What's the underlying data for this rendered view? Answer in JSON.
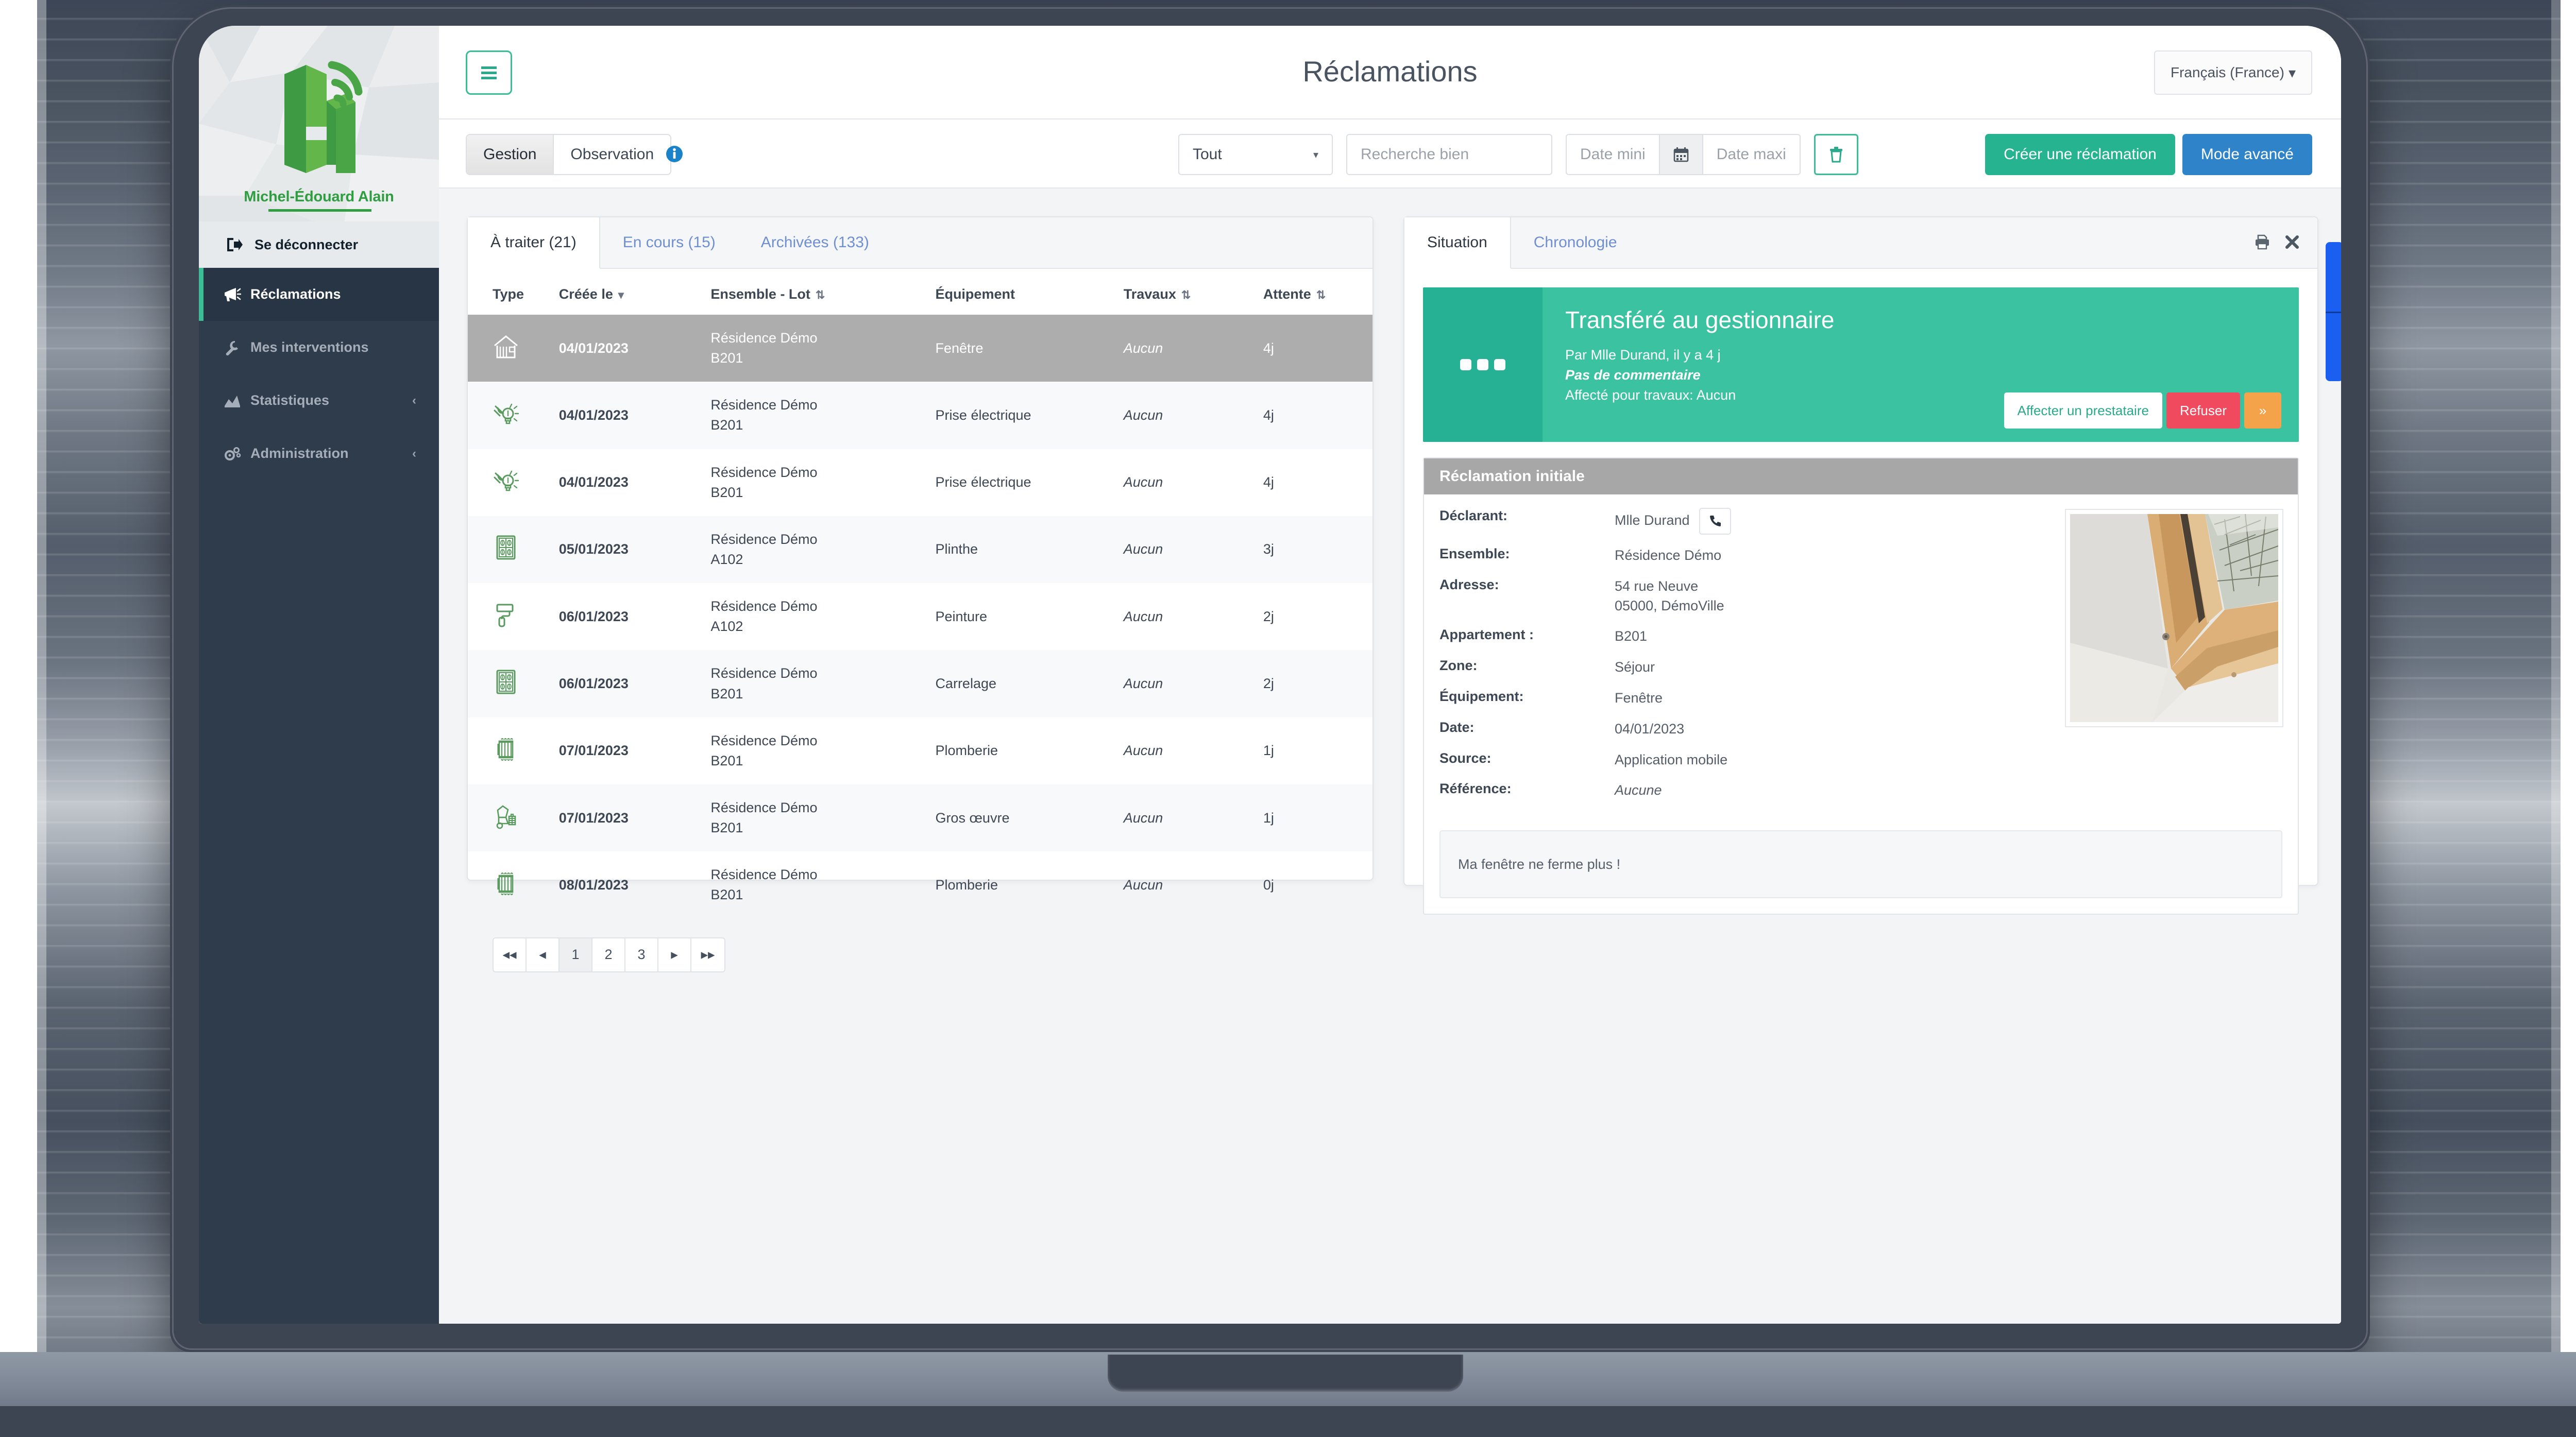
{
  "sidebar": {
    "brand_name": "Michel-Édouard Alain",
    "logout_label": "Se déconnecter",
    "items": [
      {
        "label": "Réclamations",
        "icon": "megaphone-icon",
        "active": true,
        "chevron": ""
      },
      {
        "label": "Mes interventions",
        "icon": "wrench-icon",
        "active": false,
        "chevron": ""
      },
      {
        "label": "Statistiques",
        "icon": "chart-icon",
        "active": false,
        "chevron": "‹"
      },
      {
        "label": "Administration",
        "icon": "gears-icon",
        "active": false,
        "chevron": "‹"
      }
    ]
  },
  "topbar": {
    "title": "Réclamations",
    "menu_icon": "hamburger-icon",
    "language": "Français (France)",
    "language_caret": "▾"
  },
  "filterbar": {
    "segments": [
      {
        "label": "Gestion",
        "active": true
      },
      {
        "label": "Observation",
        "active": false
      }
    ],
    "info_icon": "info-icon",
    "select_all_value": "Tout",
    "select_caret": "▾",
    "search_placeholder": "Recherche bien",
    "date_min_placeholder": "Date mini",
    "date_max_placeholder": "Date maxi",
    "calendar_icon": "calendar-icon",
    "trash_icon": "trash-icon",
    "create_button": "Créer une réclamation",
    "advanced_button": "Mode avancé"
  },
  "list_panel": {
    "tabs": [
      {
        "label": "À traiter (21)",
        "active": true
      },
      {
        "label": "En cours (15)",
        "active": false
      },
      {
        "label": "Archivées (133)",
        "active": false
      }
    ],
    "columns": [
      {
        "label": "Type",
        "sort": ""
      },
      {
        "label": "Créée le",
        "sort": "▾"
      },
      {
        "label": "Ensemble - Lot",
        "sort": "⇅"
      },
      {
        "label": "Équipement",
        "sort": ""
      },
      {
        "label": "Travaux",
        "sort": "⇅"
      },
      {
        "label": "Attente",
        "sort": "⇅"
      }
    ],
    "rows": [
      {
        "icon": "house-icon",
        "date": "04/01/2023",
        "ensemble": "Résidence Démo",
        "lot": "B201",
        "equipement": "Fenêtre",
        "travaux": "Aucun",
        "attente": "4j",
        "selected": true
      },
      {
        "icon": "electric-icon",
        "date": "04/01/2023",
        "ensemble": "Résidence Démo",
        "lot": "B201",
        "equipement": "Prise électrique",
        "travaux": "Aucun",
        "attente": "4j",
        "selected": false
      },
      {
        "icon": "electric-icon",
        "date": "04/01/2023",
        "ensemble": "Résidence Démo",
        "lot": "B201",
        "equipement": "Prise électrique",
        "travaux": "Aucun",
        "attente": "4j",
        "selected": false
      },
      {
        "icon": "tile-icon",
        "date": "05/01/2023",
        "ensemble": "Résidence Démo",
        "lot": "A102",
        "equipement": "Plinthe",
        "travaux": "Aucun",
        "attente": "3j",
        "selected": false
      },
      {
        "icon": "roller-icon",
        "date": "06/01/2023",
        "ensemble": "Résidence Démo",
        "lot": "A102",
        "equipement": "Peinture",
        "travaux": "Aucun",
        "attente": "2j",
        "selected": false
      },
      {
        "icon": "tile-icon",
        "date": "06/01/2023",
        "ensemble": "Résidence Démo",
        "lot": "B201",
        "equipement": "Carrelage",
        "travaux": "Aucun",
        "attente": "2j",
        "selected": false
      },
      {
        "icon": "radiator-icon",
        "date": "07/01/2023",
        "ensemble": "Résidence Démo",
        "lot": "B201",
        "equipement": "Plomberie",
        "travaux": "Aucun",
        "attente": "1j",
        "selected": false
      },
      {
        "icon": "mixer-icon",
        "date": "07/01/2023",
        "ensemble": "Résidence Démo",
        "lot": "B201",
        "equipement": "Gros œuvre",
        "travaux": "Aucun",
        "attente": "1j",
        "selected": false
      },
      {
        "icon": "radiator-icon",
        "date": "08/01/2023",
        "ensemble": "Résidence Démo",
        "lot": "B201",
        "equipement": "Plomberie",
        "travaux": "Aucun",
        "attente": "0j",
        "selected": false
      }
    ],
    "pagination": [
      {
        "label": "◂◂",
        "current": false
      },
      {
        "label": "◂",
        "current": false
      },
      {
        "label": "1",
        "current": true
      },
      {
        "label": "2",
        "current": false
      },
      {
        "label": "3",
        "current": false
      },
      {
        "label": "▸",
        "current": false
      },
      {
        "label": "▸▸",
        "current": false
      }
    ]
  },
  "detail_panel": {
    "tabs": [
      {
        "label": "Situation",
        "active": true
      },
      {
        "label": "Chronologie",
        "active": false
      }
    ],
    "print_icon": "print-icon",
    "close_icon": "close-icon",
    "status": {
      "dots_icon": "ellipsis-icon",
      "title": "Transféré au gestionnaire",
      "by": "Par Mlle Durand, il y a 4 j",
      "comment": "Pas de commentaire",
      "assignment": "Affecté pour travaux: Aucun",
      "assign_button": "Affecter un prestataire",
      "refuse_button": "Refuser",
      "forward_button": "»",
      "color": "#3bc2a1",
      "refuse_color": "#ef4a5e",
      "forward_color": "#f5a34a"
    },
    "initial": {
      "heading": "Réclamation initiale",
      "fields": [
        {
          "label": "Déclarant:",
          "value": "Mlle Durand",
          "phone_icon": "phone-icon",
          "italic": false
        },
        {
          "label": "Ensemble:",
          "value": "Résidence Démo",
          "italic": false
        },
        {
          "label": "Adresse:",
          "value": "54 rue Neuve\n05000, DémoVille",
          "italic": false
        },
        {
          "label": "Appartement :",
          "value": "B201",
          "italic": false
        },
        {
          "label": "Zone:",
          "value": "Séjour",
          "italic": false
        },
        {
          "label": "Équipement:",
          "value": "Fenêtre",
          "italic": false
        },
        {
          "label": "Date:",
          "value": "04/01/2023",
          "italic": false
        },
        {
          "label": "Source:",
          "value": "Application mobile",
          "italic": false
        },
        {
          "label": "Référence:",
          "value": "Aucune",
          "italic": true
        }
      ],
      "photo_alt": "photo-fenetre-toit",
      "comment_text": "Ma fenêtre ne ferme plus !"
    }
  },
  "colors": {
    "accent_green": "#3bbd96",
    "brand_green": "#2f9e41",
    "sidebar_bg": "#2f3c4c",
    "status_green": "#3bc2a1",
    "blue": "#2e83c9",
    "side_tab_blue": "#1a5ff0"
  }
}
